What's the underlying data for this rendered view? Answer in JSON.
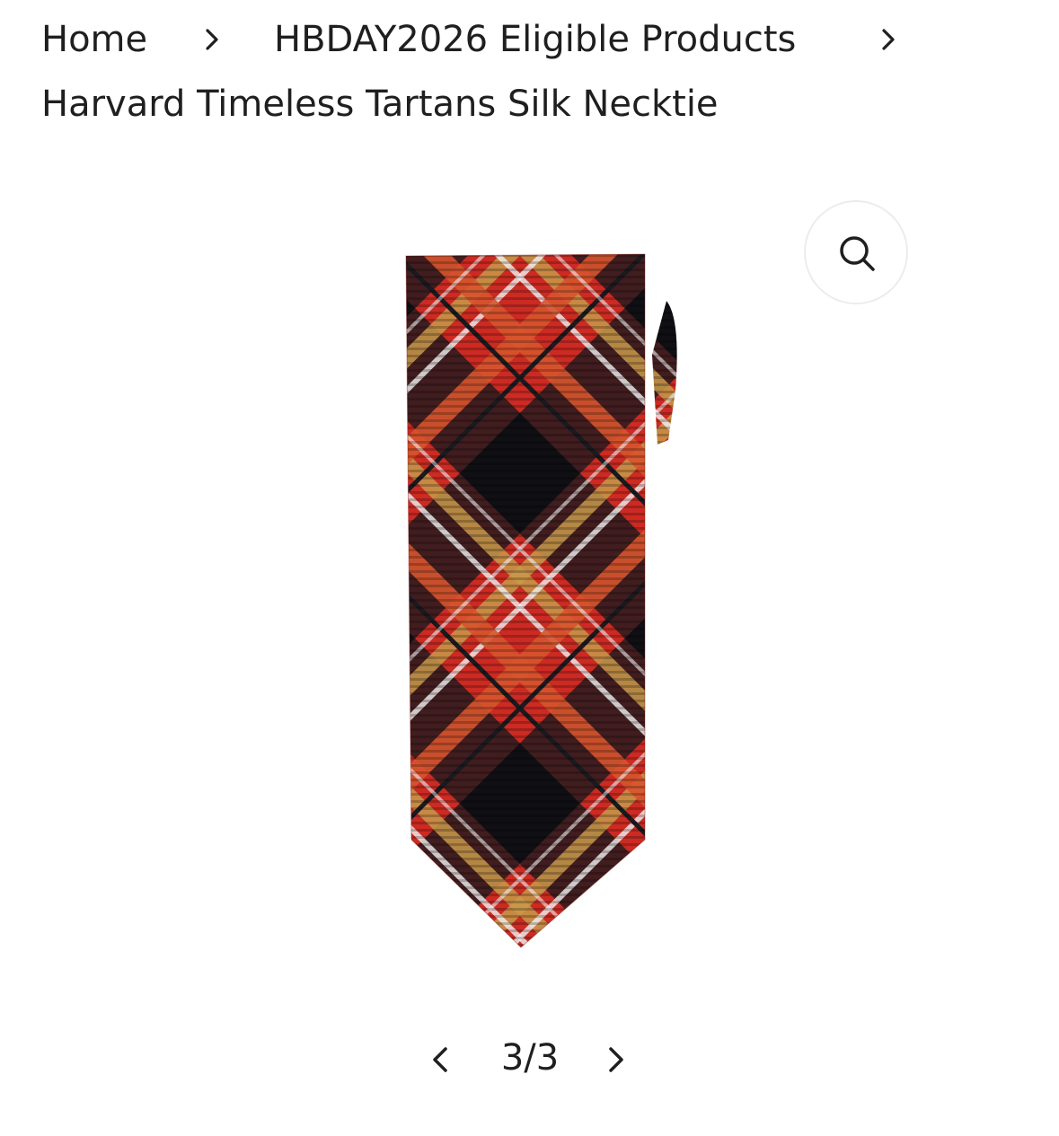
{
  "breadcrumb": {
    "home": "Home",
    "collection": "HBDAY2026 Eligible Products",
    "current": "Harvard Timeless Tartans Silk Necktie"
  },
  "gallery": {
    "zoom_icon": "search-icon",
    "product_image": "plaid-necktie",
    "pager": {
      "current": "3/3",
      "prev_icon": "chevron-left-icon",
      "next_icon": "chevron-right-icon"
    }
  },
  "colors": {
    "text": "#1f1f1f",
    "tie_red": "#cc2a22",
    "tie_black": "#1a1a1f",
    "tie_gold": "#c89a4a",
    "tie_orange": "#d8542e"
  }
}
